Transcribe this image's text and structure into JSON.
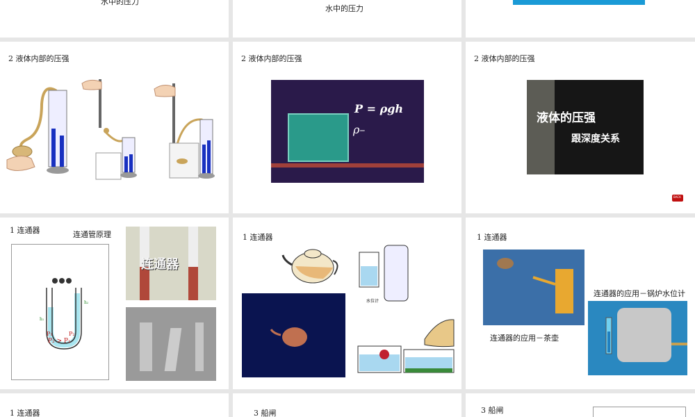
{
  "row0": {
    "s1_caption": "水中的压力",
    "s2_caption": "水中的压力"
  },
  "row1": {
    "s1_title": "2  液体内部的压强",
    "s2_title": "2  液体内部的压强",
    "s3_title": "2  液体内部的压强",
    "formula_main": "P = ρgh",
    "formula_sub": "ρ–",
    "video_text_1": "液体的压强",
    "video_text_2": "跟深度关系",
    "back_button": "BACK"
  },
  "row2": {
    "s1_title": "1  连通器",
    "s1_subtitle": "连通管原理",
    "diagram_p1": "P₁",
    "diagram_p2": "P₂",
    "diagram_relation": "P₂ > P₁",
    "diagram_h1": "h₁",
    "diagram_h2": "h₂",
    "photo_text": "连通器",
    "s2_title": "1  连通器",
    "water_gauge_label": "水位计",
    "s3_title": "1  连通器",
    "s3_caption_teapot": "连通器的应用－茶壶",
    "s3_caption_boiler": "连通器的应用－锅炉水位计"
  },
  "row3": {
    "s1_title": "1  连通器",
    "s2_title": "3  船闸",
    "s3_title": "3  船闸"
  },
  "colors": {
    "background": "#e6e6e6",
    "slide": "#ffffff",
    "navy": "#0a1450",
    "purple": "#2a1a4a",
    "blue_bar": "#1a9ad6",
    "back_red": "#c01010"
  }
}
